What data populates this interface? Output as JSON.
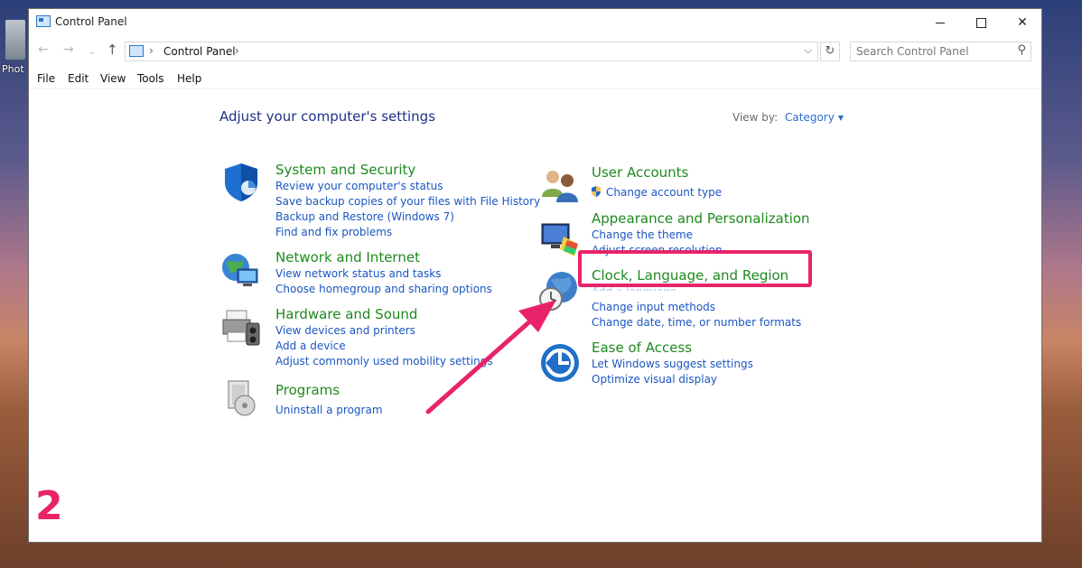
{
  "desktop": {
    "icon_label": "Phot"
  },
  "window": {
    "title": "Control Panel",
    "controls": {
      "minimize": "minimize",
      "maximize": "maximize",
      "close": "✕"
    }
  },
  "address": {
    "crumb": "Control Panel",
    "search_placeholder": "Search Control Panel"
  },
  "menu": [
    "File",
    "Edit",
    "View",
    "Tools",
    "Help"
  ],
  "page": {
    "heading": "Adjust your computer's settings",
    "view_by_label": "View by:",
    "view_by_value": "Category"
  },
  "categories": {
    "system_security": {
      "title": "System and Security",
      "links": [
        "Review your computer's status",
        "Save backup copies of your files with File History",
        "Backup and Restore (Windows 7)",
        "Find and fix problems"
      ]
    },
    "network_internet": {
      "title": "Network and Internet",
      "links": [
        "View network status and tasks",
        "Choose homegroup and sharing options"
      ]
    },
    "hardware_sound": {
      "title": "Hardware and Sound",
      "links": [
        "View devices and printers",
        "Add a device",
        "Adjust commonly used mobility settings"
      ]
    },
    "programs": {
      "title": "Programs",
      "links": [
        "Uninstall a program"
      ]
    },
    "user_accounts": {
      "title": "User Accounts",
      "links": [
        "Change account type"
      ]
    },
    "appearance": {
      "title": "Appearance and Personalization",
      "links": [
        "Change the theme",
        "Adjust screen resolution"
      ]
    },
    "clock_region": {
      "title": "Clock, Language, and Region",
      "links": [
        "Add a language",
        "Change input methods",
        "Change date, time, or number formats"
      ]
    },
    "ease_access": {
      "title": "Ease of Access",
      "links": [
        "Let Windows suggest settings",
        "Optimize visual display"
      ]
    }
  },
  "annotation": {
    "step_number": "2",
    "color": "#e8236a"
  },
  "colors": {
    "title_green": "#1e8a1e",
    "link_blue": "#1a56c2",
    "heading_blue": "#1e3287"
  }
}
